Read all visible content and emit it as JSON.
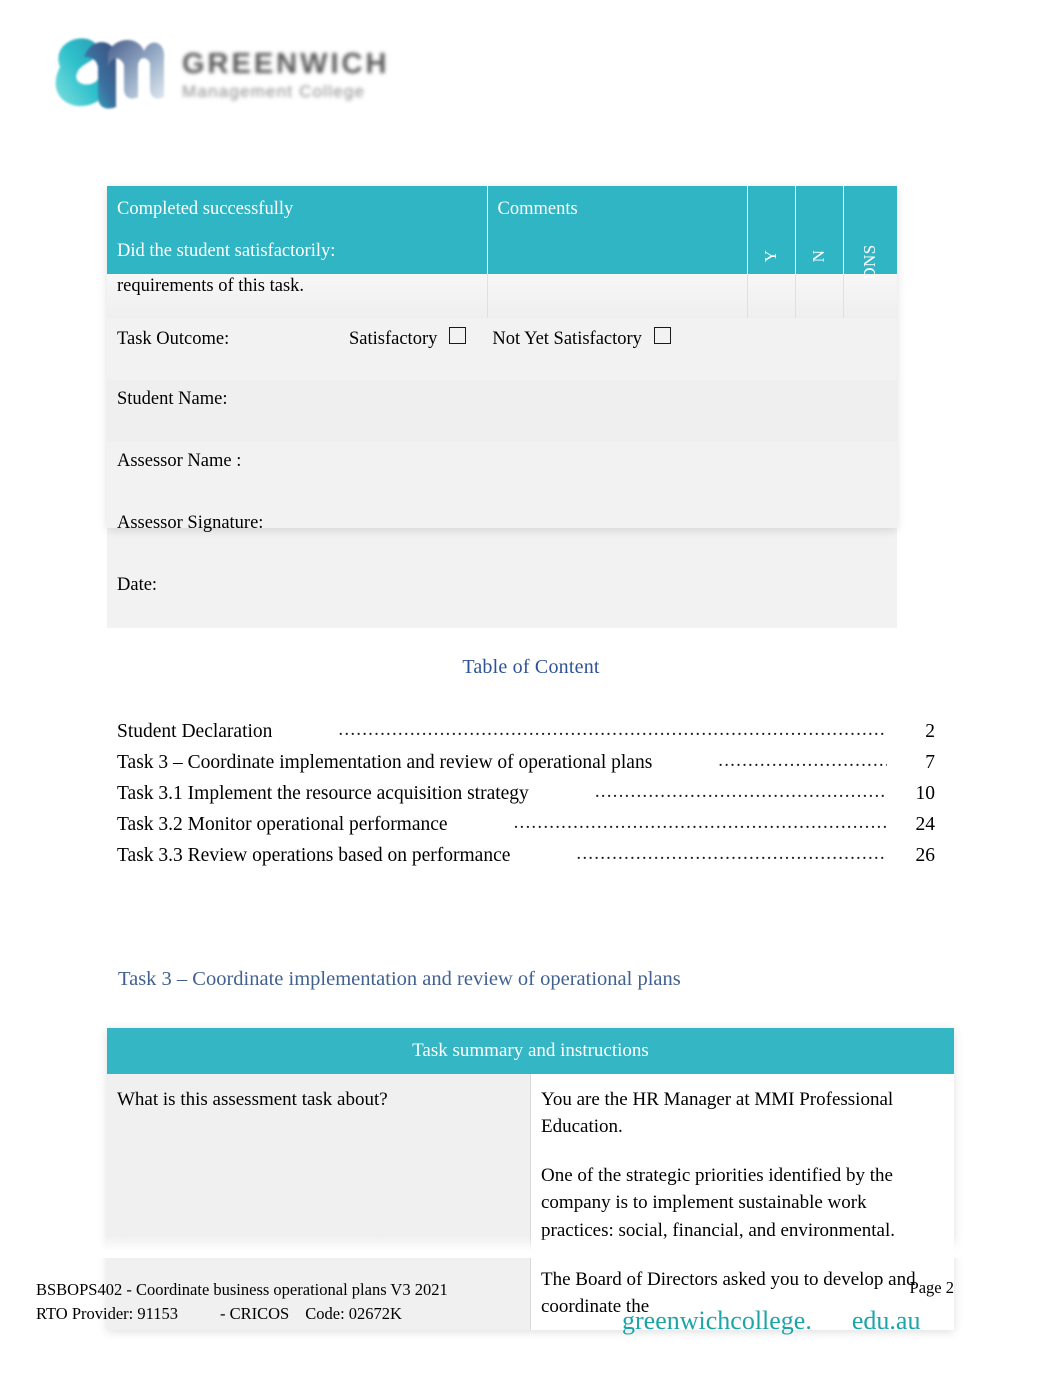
{
  "logo": {
    "mark_alt": "greenwich-management-college-logo",
    "wordmark_main": "GREENWICH",
    "wordmark_sub": "Management College",
    "mark_color_teal": "#2ec0cb",
    "mark_color_navy": "#3b4f7d"
  },
  "assessment_table": {
    "accent_color": "#2FB5C4",
    "header": {
      "col1_line1": "Completed successfully",
      "col1_line2": "Did the student satisfactorily:",
      "col2": "Comments",
      "col_y": "Y",
      "col_n": "N",
      "col_dns": "DNS"
    },
    "continued_row": "requirements of this task.",
    "rows": [
      {
        "label": "Task Outcome:",
        "option_satisfactory": "Satisfactory",
        "option_not_yet": "Not Yet Satisfactory"
      },
      {
        "label": "Student Name:"
      },
      {
        "label": "Assessor Name :"
      },
      {
        "label": "Assessor Signature:"
      },
      {
        "label": "Date:"
      }
    ]
  },
  "toc": {
    "title": "Table of Content",
    "title_color": "#2E5395",
    "entries": [
      {
        "label": "Student Declaration",
        "dots": "..................................................................................................................",
        "page": "2",
        "gap": 60,
        "dotwidth": 0
      },
      {
        "label": "Task 3 – Coordinate implementation and review of operational plans",
        "dots": "...................................",
        "page": "7",
        "gap": 60,
        "dotwidth": 0
      },
      {
        "label": "Task 3.1 Implement the resource acquisition strategy",
        "dots": "..........................................................",
        "page": "10",
        "gap": 60,
        "dotwidth": 0
      },
      {
        "label": "Task 3.2 Monitor operational performance",
        "dots": "............................................................................",
        "page": "24",
        "gap": 60,
        "dotwidth": 0
      },
      {
        "label": "Task 3.3 Review operations based on performance",
        "dots": "...........................................................",
        "page": "26",
        "gap": 60,
        "dotwidth": 0
      }
    ]
  },
  "task_section": {
    "heading": "Task 3 – Coordinate implementation and review of operational plans",
    "heading_color": "#41618F",
    "summary_table": {
      "accent_color": "#34B6C4",
      "header": "Task summary and instructions",
      "row_label": "What is this assessment task about?",
      "paragraphs": [
        "You are the HR Manager at MMI Professional Education.",
        "One of the strategic priorities identified by the company is to implement sustainable work practices: social, financial, and environmental.",
        "The Board of Directors asked you to develop and coordinate the"
      ]
    }
  },
  "footer": {
    "line1": "BSBOPS402 - Coordinate business operational plans V3 2021",
    "line2_a": "RTO Provider: 91153",
    "line2_b": "- CRICOS",
    "line2_c": "Code: 02672K",
    "page_label": "Page 2",
    "brand_name": "greenwichcollege.",
    "brand_domain": "edu.au",
    "brand_color": "#1CA5A8"
  }
}
